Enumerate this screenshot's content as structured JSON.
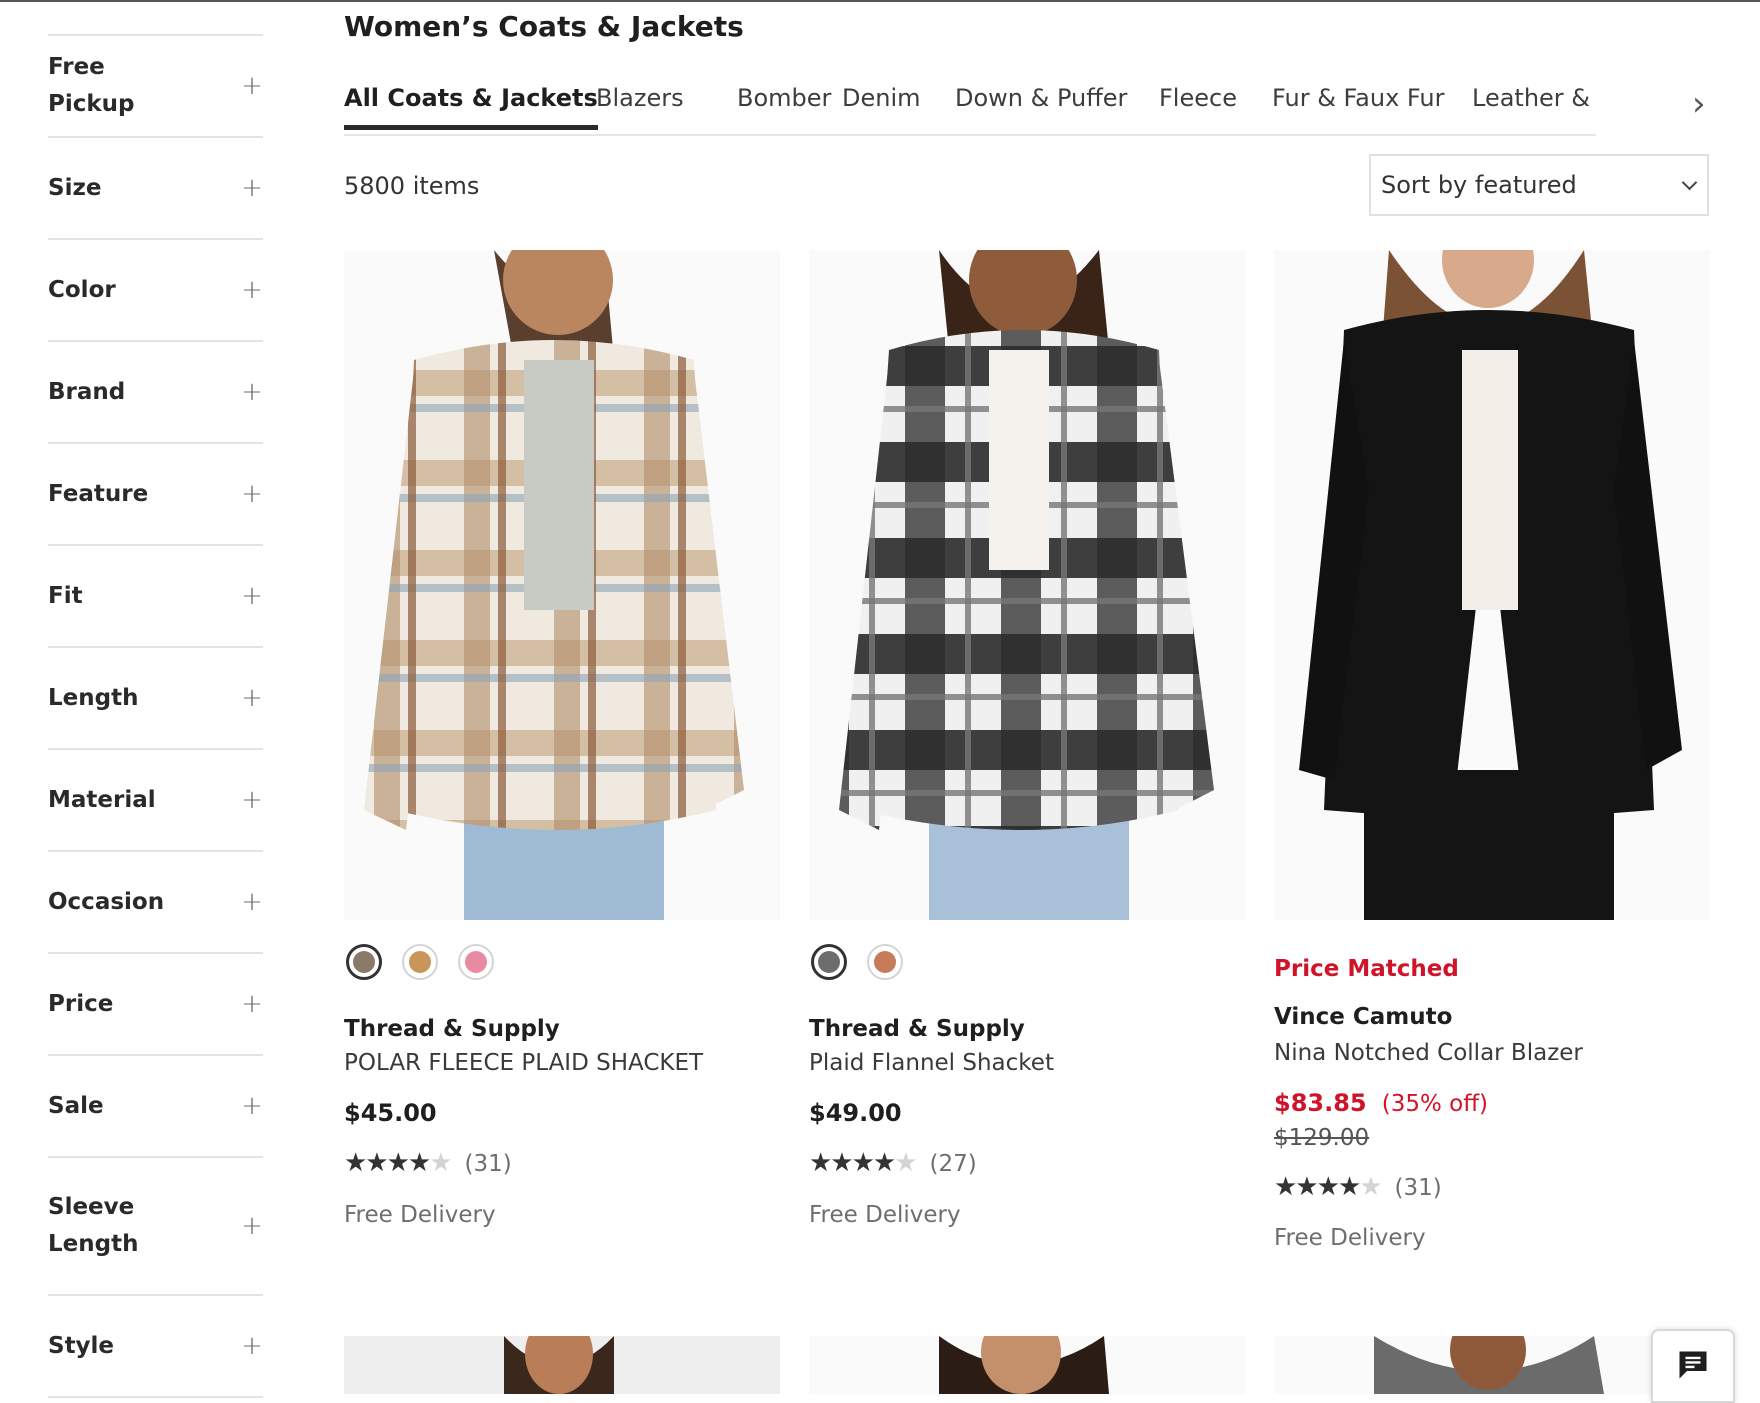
{
  "filters": [
    {
      "label": "Free Pickup"
    },
    {
      "label": "Size"
    },
    {
      "label": "Color"
    },
    {
      "label": "Brand"
    },
    {
      "label": "Feature"
    },
    {
      "label": "Fit"
    },
    {
      "label": "Length"
    },
    {
      "label": "Material"
    },
    {
      "label": "Occasion"
    },
    {
      "label": "Price"
    },
    {
      "label": "Sale"
    },
    {
      "label": "Sleeve Length"
    },
    {
      "label": "Style"
    }
  ],
  "expand_symbol": "+",
  "page_title": "Women’s Coats & Jackets",
  "tabs": [
    {
      "label": "All Coats & Jackets",
      "active": true
    },
    {
      "label": "Blazers"
    },
    {
      "label": "Bomber"
    },
    {
      "label": "Denim"
    },
    {
      "label": "Down & Puffer"
    },
    {
      "label": "Fleece"
    },
    {
      "label": "Fur & Faux Fur"
    },
    {
      "label": "Leather & Faux I"
    }
  ],
  "tabs_next_icon": "›",
  "item_count": "5800 items",
  "sort_label": "Sort by featured",
  "products": [
    {
      "swatches": [
        "#8a7a6a",
        "#c9955a",
        "#e98aa3"
      ],
      "brand": "Thread & Supply",
      "name": "POLAR FLEECE PLAID SHACKET",
      "price": "$45.00",
      "rating": 4,
      "stars_full": "★★★★",
      "stars_empty": "★",
      "reviews": "(31)",
      "delivery": "Free Delivery"
    },
    {
      "swatches": [
        "#6d6d6d",
        "#c67b5a"
      ],
      "brand": "Thread & Supply",
      "name": "Plaid Flannel Shacket",
      "price": "$49.00",
      "rating": 4,
      "stars_full": "★★★★",
      "stars_empty": "★",
      "reviews": "(27)",
      "delivery": "Free Delivery"
    },
    {
      "badge": "Price Matched",
      "brand": "Vince Camuto",
      "name": "Nina Notched Collar Blazer",
      "sale_price": "$83.85",
      "discount": "(35% off)",
      "original_price": "$129.00",
      "rating": 4,
      "stars_full": "★★★★",
      "stars_empty": "★",
      "reviews": "(31)",
      "delivery": "Free Delivery"
    }
  ],
  "colors": {
    "sale_red": "#d1132a",
    "text": "#1f1f1f",
    "muted": "#6e6e6e"
  },
  "chat_icon": "chat-icon"
}
